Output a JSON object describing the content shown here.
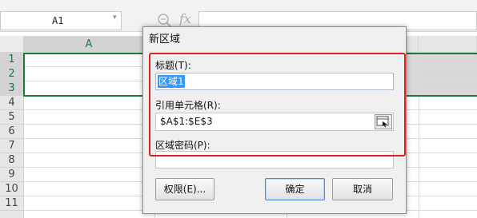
{
  "formula_bar": {
    "name_box": "A1",
    "fx_label": "fx",
    "formula_value": ""
  },
  "sheet": {
    "columns": [
      "A",
      "",
      "",
      ""
    ],
    "rows": [
      "1",
      "2",
      "3",
      "4",
      "5",
      "6",
      "7",
      "8",
      "9",
      "10",
      "11"
    ],
    "selected_range": "A1:E3"
  },
  "dialog": {
    "title": "新区域",
    "title_label": "标题(T):",
    "title_value": "区域1",
    "ref_label": "引用单元格(R):",
    "ref_value": "$A$1:$E$3",
    "password_label": "区域密码(P):",
    "password_value": "",
    "permissions_button": "权限(E)...",
    "ok_button": "确定",
    "cancel_button": "取消"
  },
  "colors": {
    "selection_border": "#1f7a3e",
    "annotation_box": "#e0231b",
    "text_highlight": "#3399ff"
  },
  "icons": [
    "zoom-icon",
    "fx-icon",
    "dropdown-icon",
    "range-picker-icon"
  ]
}
